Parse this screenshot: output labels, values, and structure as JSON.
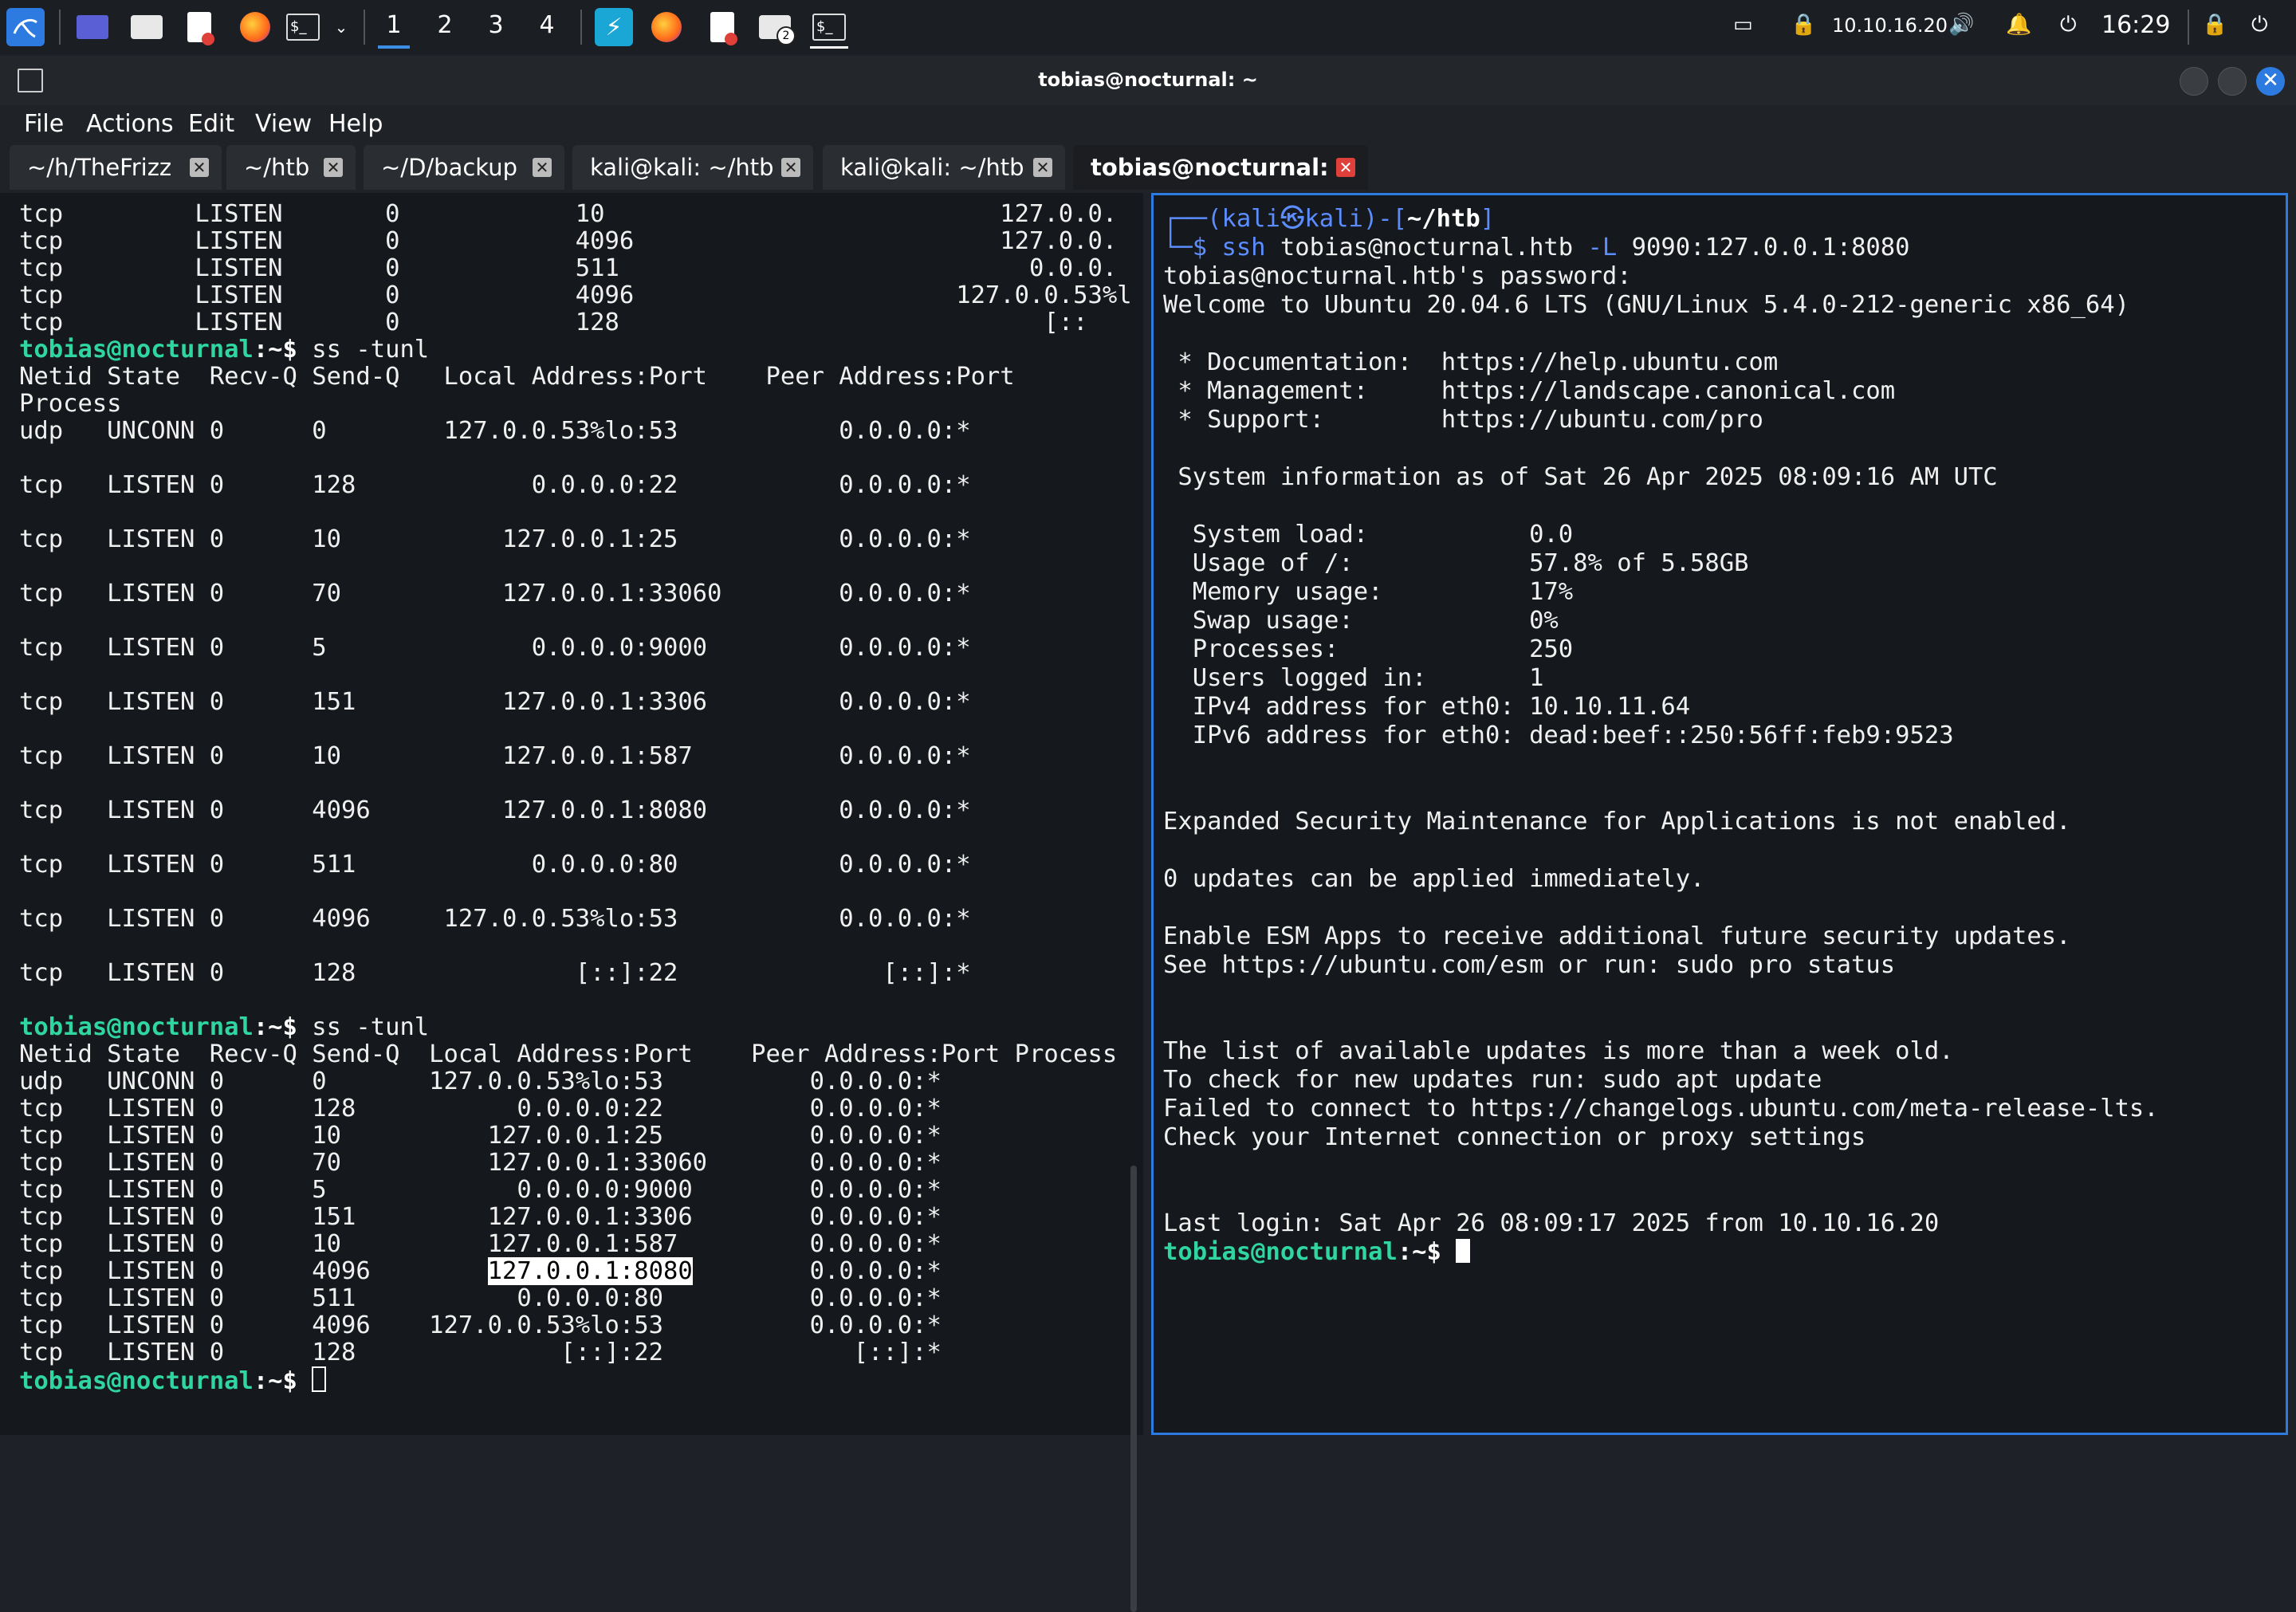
{
  "taskbar": {
    "workspaces": [
      "1",
      "2",
      "3",
      "4"
    ],
    "ip": "10.10.16.20",
    "clock": "16:29"
  },
  "window": {
    "title": "tobias@nocturnal: ~"
  },
  "menu": [
    "File",
    "Actions",
    "Edit",
    "View",
    "Help"
  ],
  "tabs": [
    "~/h/TheFrizz",
    "~/htb",
    "~/D/backup",
    "kali@kali: ~/htb",
    "kali@kali: ~/htb",
    "tobias@nocturnal: ~"
  ],
  "left_terminal": {
    "prompt_user": "tobias@nocturnal",
    "prompt_path": ":~$",
    "top_rows": [
      "tcp         LISTEN       0            10                           127.0.0.",
      "tcp         LISTEN       0            4096                         127.0.0.",
      "tcp         LISTEN       0            511                            0.0.0.",
      "tcp         LISTEN       0            4096                      127.0.0.53%l",
      "tcp         LISTEN       0            128                             [::"
    ],
    "command1": " ss -tunl",
    "block1": [
      "Netid State  Recv-Q Send-Q   Local Address:Port    Peer Address:Port",
      "Process",
      "udp   UNCONN 0      0        127.0.0.53%lo:53           0.0.0.0:*",
      "",
      "tcp   LISTEN 0      128            0.0.0.0:22           0.0.0.0:*",
      "",
      "tcp   LISTEN 0      10           127.0.0.1:25           0.0.0.0:*",
      "",
      "tcp   LISTEN 0      70           127.0.0.1:33060        0.0.0.0:*",
      "",
      "tcp   LISTEN 0      5              0.0.0.0:9000         0.0.0.0:*",
      "",
      "tcp   LISTEN 0      151          127.0.0.1:3306         0.0.0.0:*",
      "",
      "tcp   LISTEN 0      10           127.0.0.1:587          0.0.0.0:*",
      "",
      "tcp   LISTEN 0      4096         127.0.0.1:8080         0.0.0.0:*",
      "",
      "tcp   LISTEN 0      511            0.0.0.0:80           0.0.0.0:*",
      "",
      "tcp   LISTEN 0      4096     127.0.0.53%lo:53           0.0.0.0:*",
      "",
      "tcp   LISTEN 0      128               [::]:22              [::]:*",
      ""
    ],
    "command2": " ss -tunl",
    "block2_header": "Netid State  Recv-Q Send-Q  Local Address:Port    Peer Address:Port Process",
    "block2": [
      "udp   UNCONN 0      0       127.0.0.53%lo:53          0.0.0.0:*",
      "tcp   LISTEN 0      128           0.0.0.0:22          0.0.0.0:*",
      "tcp   LISTEN 0      10          127.0.0.1:25          0.0.0.0:*",
      "tcp   LISTEN 0      70          127.0.0.1:33060       0.0.0.0:*",
      "tcp   LISTEN 0      5             0.0.0.0:9000        0.0.0.0:*",
      "tcp   LISTEN 0      151         127.0.0.1:3306        0.0.0.0:*",
      "tcp   LISTEN 0      10          127.0.0.1:587         0.0.0.0:*"
    ],
    "row8080_prefix": "tcp   LISTEN 0      4096        ",
    "row8080_highlight": "127.0.0.1:8080",
    "row8080_suffix": "        0.0.0.0:*",
    "block2_tail": [
      "tcp   LISTEN 0      511           0.0.0.0:80          0.0.0.0:*",
      "tcp   LISTEN 0      4096    127.0.0.53%lo:53          0.0.0.0:*",
      "tcp   LISTEN 0      128              [::]:22             [::]:*"
    ]
  },
  "right_terminal": {
    "prompt_line1_a": "┌──(",
    "prompt_kali": "kali㉿kali",
    "prompt_line1_b": ")-[",
    "prompt_dir": "~/htb",
    "prompt_line1_c": "]",
    "prompt_line2": "└─$",
    "ssh_cmd": " ssh",
    "ssh_target": " tobias@nocturnal.htb",
    "ssh_flag": " -L",
    "ssh_fwd": " 9090:127.0.0.1:8080",
    "output": [
      "tobias@nocturnal.htb's password:",
      "Welcome to Ubuntu 20.04.6 LTS (GNU/Linux 5.4.0-212-generic x86_64)",
      "",
      " * Documentation:  https://help.ubuntu.com",
      " * Management:     https://landscape.canonical.com",
      " * Support:        https://ubuntu.com/pro",
      "",
      " System information as of Sat 26 Apr 2025 08:09:16 AM UTC",
      "",
      "  System load:           0.0",
      "  Usage of /:            57.8% of 5.58GB",
      "  Memory usage:          17%",
      "  Swap usage:            0%",
      "  Processes:             250",
      "  Users logged in:       1",
      "  IPv4 address for eth0: 10.10.11.64",
      "  IPv6 address for eth0: dead:beef::250:56ff:feb9:9523",
      "",
      "",
      "Expanded Security Maintenance for Applications is not enabled.",
      "",
      "0 updates can be applied immediately.",
      "",
      "Enable ESM Apps to receive additional future security updates.",
      "See https://ubuntu.com/esm or run: sudo pro status",
      "",
      "",
      "The list of available updates is more than a week old.",
      "To check for new updates run: sudo apt update",
      "Failed to connect to https://changelogs.ubuntu.com/meta-release-lts.",
      "Check your Internet connection or proxy settings",
      "",
      "",
      "Last login: Sat Apr 26 08:09:17 2025 from 10.10.16.20"
    ],
    "prompt_user": "tobias@nocturnal",
    "prompt_path": ":~$"
  }
}
